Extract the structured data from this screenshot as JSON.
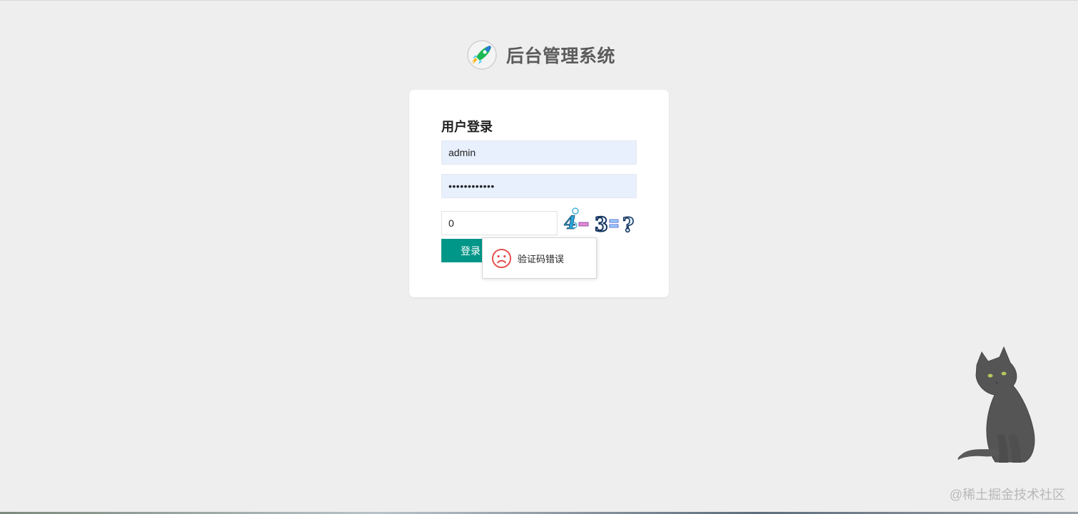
{
  "app": {
    "title": "后台管理系统",
    "logo_icon": "rocket-icon"
  },
  "login": {
    "heading": "用户登录",
    "username_value": "admin",
    "password_value": "••••••••••••",
    "captcha_value": "0",
    "captcha_image_text": "4-3=?",
    "submit_label": "登录"
  },
  "toast": {
    "icon": "sad-face-icon",
    "message": "验证码错误"
  },
  "decoration": {
    "mascot_icon": "black-cat-icon"
  },
  "watermark": {
    "text": "@稀土掘金技术社区"
  },
  "colors": {
    "background": "#eeeeee",
    "primary": "#009688",
    "input_fill": "#e8f0fe",
    "error_icon": "#e64a4a"
  }
}
